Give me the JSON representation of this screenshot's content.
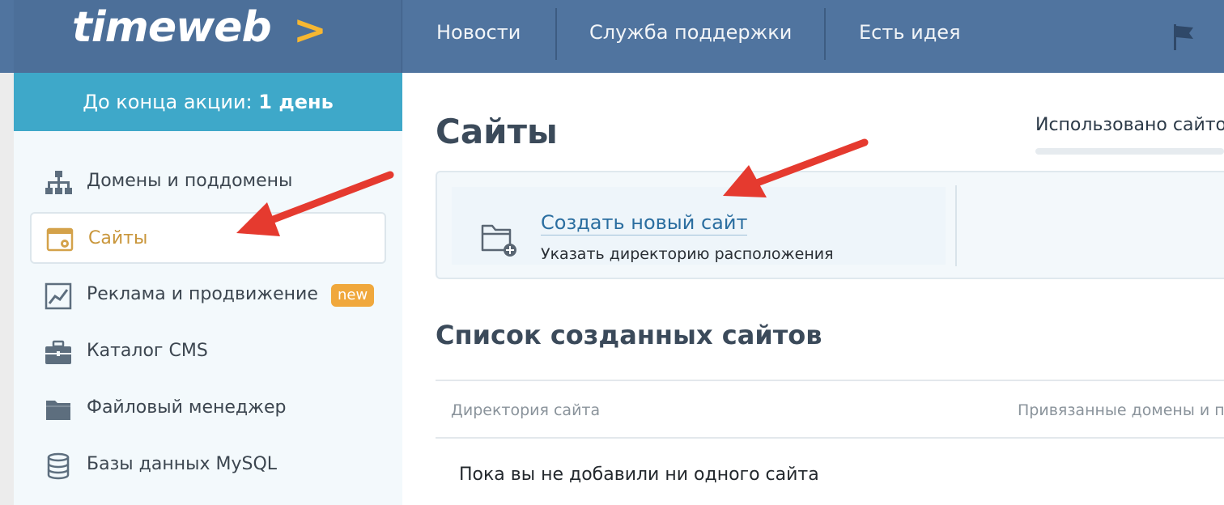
{
  "header": {
    "logo_text": "timeweb",
    "logo_mark": ">",
    "nav": [
      {
        "label": "Новости"
      },
      {
        "label": "Служба поддержки"
      },
      {
        "label": "Есть идея"
      }
    ],
    "flag_icon": "flag-icon"
  },
  "sidebar": {
    "promo_prefix": "До конца акции:",
    "promo_value": "1 день",
    "items": [
      {
        "label": "Домены и поддомены",
        "icon": "sitemap-icon"
      },
      {
        "label": "Сайты",
        "icon": "website-gear-icon",
        "active": true
      },
      {
        "label": "Реклама и продвижение",
        "icon": "chart-icon",
        "badge": "new"
      },
      {
        "label": "Каталог CMS",
        "icon": "briefcase-icon"
      },
      {
        "label": "Файловый менеджер",
        "icon": "folder-icon"
      },
      {
        "label": "Базы данных MySQL",
        "icon": "database-icon"
      }
    ]
  },
  "main": {
    "title": "Сайты",
    "usage_label": "Использовано сайто",
    "create": {
      "link": "Создать новый сайт",
      "subtitle": "Указать директорию расположения",
      "icon": "folder-plus-icon"
    },
    "list": {
      "title": "Список созданных сайтов",
      "columns": [
        "Директория сайта",
        "Привязанные домены и п"
      ],
      "empty": "Пока вы не добавили ни одного сайта"
    }
  },
  "colors": {
    "header_bg": "#50749f",
    "promo_bg": "#3ea8c9",
    "accent_active": "#c9963b",
    "link": "#2b6ea0",
    "badge": "#f0a83c",
    "annotation_arrow": "#e53a2f"
  }
}
